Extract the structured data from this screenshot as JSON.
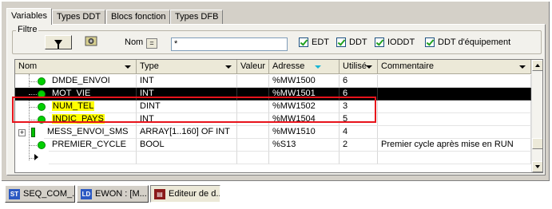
{
  "tabs": [
    {
      "label": "Variables",
      "active": true
    },
    {
      "label": "Types DDT",
      "active": false
    },
    {
      "label": "Blocs fonction",
      "active": false
    },
    {
      "label": "Types DFB",
      "active": false
    }
  ],
  "filter": {
    "group_label": "Filtre",
    "name_label": "Nom",
    "equals_label": "=",
    "name_value": "*",
    "checkboxes": [
      {
        "label": "EDT",
        "checked": true
      },
      {
        "label": "DDT",
        "checked": true
      },
      {
        "label": "IODDT",
        "checked": true
      },
      {
        "label": "DDT d'équipement",
        "checked": true
      }
    ]
  },
  "table": {
    "columns": [
      "Nom",
      "Type",
      "Valeur",
      "Adresse",
      "Utilisé",
      "Commentaire"
    ],
    "rows": [
      {
        "name": "DMDE_ENVOI",
        "type": "INT",
        "value": "",
        "address": "%MW1500",
        "used": "6",
        "comment": ""
      },
      {
        "name": "MOT_VIE",
        "type": "INT",
        "value": "",
        "address": "%MW1501",
        "used": "6",
        "comment": ""
      },
      {
        "name": "NUM_TEL",
        "type": "DINT",
        "value": "",
        "address": "%MW1502",
        "used": "3",
        "comment": ""
      },
      {
        "name": "INDIC_PAYS",
        "type": "INT",
        "value": "",
        "address": "%MW1504",
        "used": "5",
        "comment": ""
      },
      {
        "name": "MESS_ENVOI_SMS",
        "type": "ARRAY[1..160] OF INT",
        "value": "",
        "address": "%MW1510",
        "used": "4",
        "comment": ""
      },
      {
        "name": "PREMIER_CYCLE",
        "type": "BOOL",
        "value": "",
        "address": "%S13",
        "used": "2",
        "comment": "Premier cycle après mise en RUN"
      }
    ]
  },
  "taskbar": [
    {
      "label": "SEQ_COM_...",
      "icon": "st-icon"
    },
    {
      "label": "EWON : [M...",
      "icon": "ld-icon"
    },
    {
      "label": "Editeur de d...",
      "icon": "book-icon",
      "active": true
    }
  ],
  "colors": {
    "highlight": "#ffff00",
    "annotation_box": "#e8131b",
    "variable_dot": "#00d000",
    "selected_row": "#000000"
  }
}
